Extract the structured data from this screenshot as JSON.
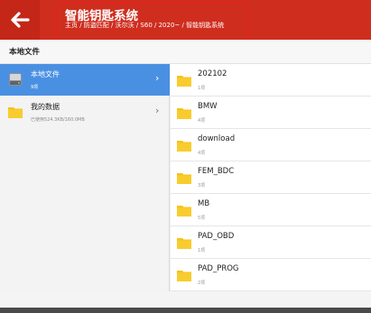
{
  "header": {
    "title": "智能钥匙系统",
    "breadcrumb": "主页 / 防盗匹配 / 沃尔沃 / S60 / 2020~ / 智能钥匙系统",
    "back_icon": "arrow-left-icon"
  },
  "section": {
    "label": "本地文件"
  },
  "sidebar": {
    "items": [
      {
        "name": "本地文件",
        "sub": "9项",
        "icon": "hard-drive-icon",
        "active": true
      },
      {
        "name": "我的数据",
        "sub": "已使用524.3KB/160.0MB",
        "icon": "folder-icon",
        "active": false
      }
    ]
  },
  "files": [
    {
      "name": "202102",
      "sub": "1项"
    },
    {
      "name": "BMW",
      "sub": "4项"
    },
    {
      "name": "download",
      "sub": "4项"
    },
    {
      "name": "FEM_BDC",
      "sub": "3项"
    },
    {
      "name": "MB",
      "sub": "5项"
    },
    {
      "name": "PAD_OBD",
      "sub": "1项"
    },
    {
      "name": "PAD_PROG",
      "sub": "2项"
    }
  ],
  "colors": {
    "header": "#cf2e1f",
    "active": "#4a90e2",
    "folder": "#f6c21c"
  }
}
